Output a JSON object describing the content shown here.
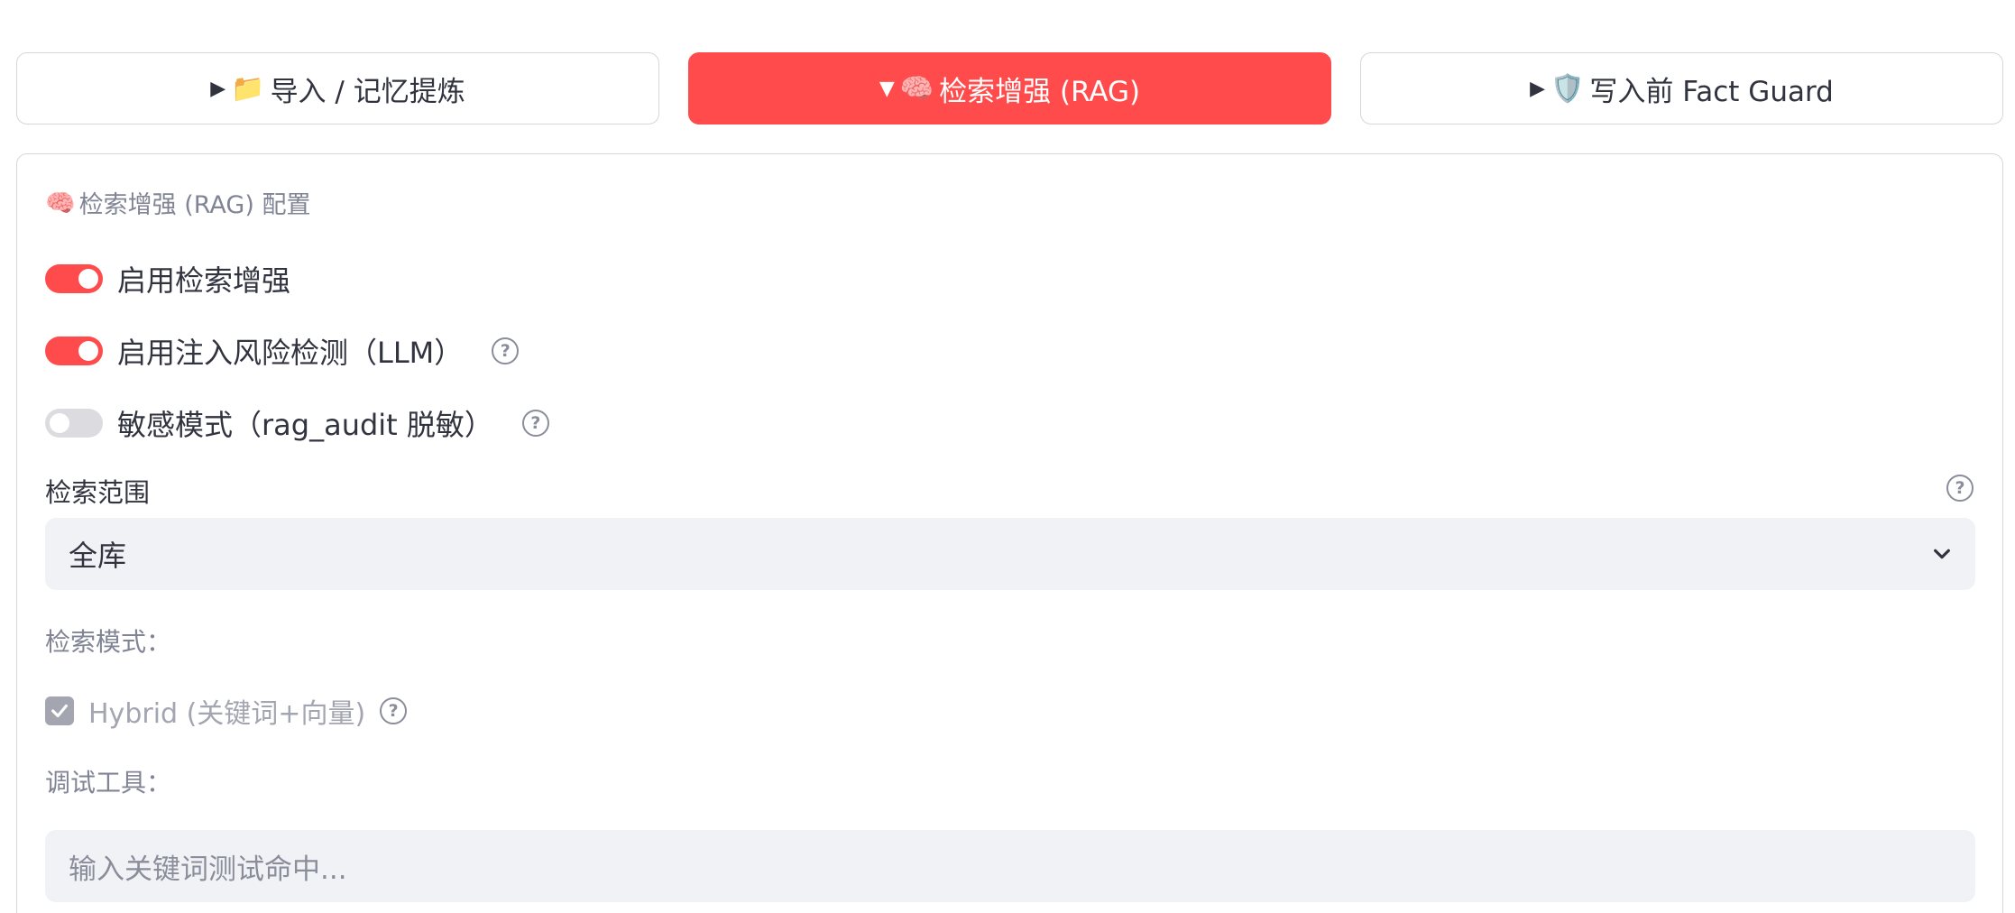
{
  "tabs": [
    {
      "arrow": "▶",
      "icon": "📁",
      "label": "导入 / 记忆提炼"
    },
    {
      "arrow": "▼",
      "icon": "🧠",
      "label": "检索增强 (RAG)"
    },
    {
      "arrow": "▶",
      "icon": "🛡️",
      "label": "写入前 Fact Guard"
    }
  ],
  "panel": {
    "section_icon": "🧠",
    "section_title": "检索增强 (RAG) 配置",
    "toggles": [
      {
        "label": "启用检索增强",
        "on": true
      },
      {
        "label": "启用注入风险检测（LLM）",
        "on": true
      },
      {
        "label": "敏感模式（rag_audit 脱敏）",
        "on": false
      }
    ],
    "scope_label": "检索范围",
    "scope_value": "全库",
    "mode_label": "检索模式：",
    "hybrid_label": "Hybrid (关键词+向量)",
    "hybrid_checked": true,
    "debug_label": "调试工具：",
    "debug_placeholder": "输入关键词测试命中..."
  },
  "help_glyph": "?",
  "colors": {
    "accent": "#ff4b4b",
    "input_bg": "#f0f2f6",
    "muted": "#808495"
  }
}
